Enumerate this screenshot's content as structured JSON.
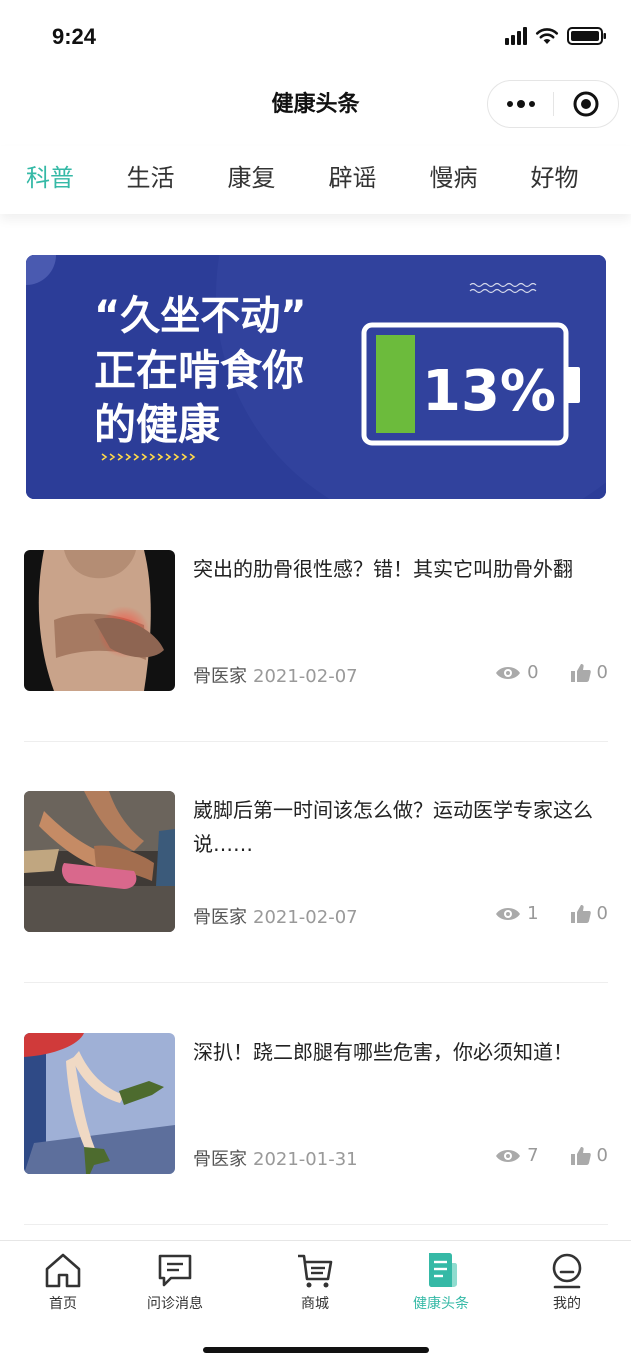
{
  "status_bar": {
    "time": "9:24"
  },
  "nav": {
    "title": "健康头条"
  },
  "tabs": [
    {
      "label": "科普",
      "active": true
    },
    {
      "label": "生活",
      "active": false
    },
    {
      "label": "康复",
      "active": false
    },
    {
      "label": "辟谣",
      "active": false
    },
    {
      "label": "慢病",
      "active": false
    },
    {
      "label": "好物",
      "active": false
    }
  ],
  "banner": {
    "line1": "“久坐不动”",
    "line2": "正在啃食你",
    "line3": "的健康",
    "battery_text": "13%",
    "battery_level": 0.13,
    "bg_color": "#2c3d98",
    "accent_color": "#ffd94a",
    "battery_fill_color": "#6cbb3c"
  },
  "articles": [
    {
      "title": "突出的肋骨很性感？错！其实它叫肋骨外翻",
      "author": "骨医家",
      "date": "2021-02-07",
      "views": "0",
      "likes": "0"
    },
    {
      "title": "崴脚后第一时间该怎么做？运动医学专家这么说……",
      "author": "骨医家",
      "date": "2021-02-07",
      "views": "1",
      "likes": "0"
    },
    {
      "title": "深扒！跷二郎腿有哪些危害，你必须知道！",
      "author": "骨医家",
      "date": "2021-01-31",
      "views": "7",
      "likes": "0"
    }
  ],
  "tabbar": [
    {
      "label": "首页",
      "icon": "home-icon"
    },
    {
      "label": "问诊消息",
      "icon": "chat-icon"
    },
    {
      "label": "商城",
      "icon": "cart-icon"
    },
    {
      "label": "健康头条",
      "icon": "news-icon",
      "active": true
    },
    {
      "label": "我的",
      "icon": "profile-icon"
    }
  ],
  "colors": {
    "accent": "#35b9a6",
    "text": "#222222",
    "muted": "#999999"
  }
}
